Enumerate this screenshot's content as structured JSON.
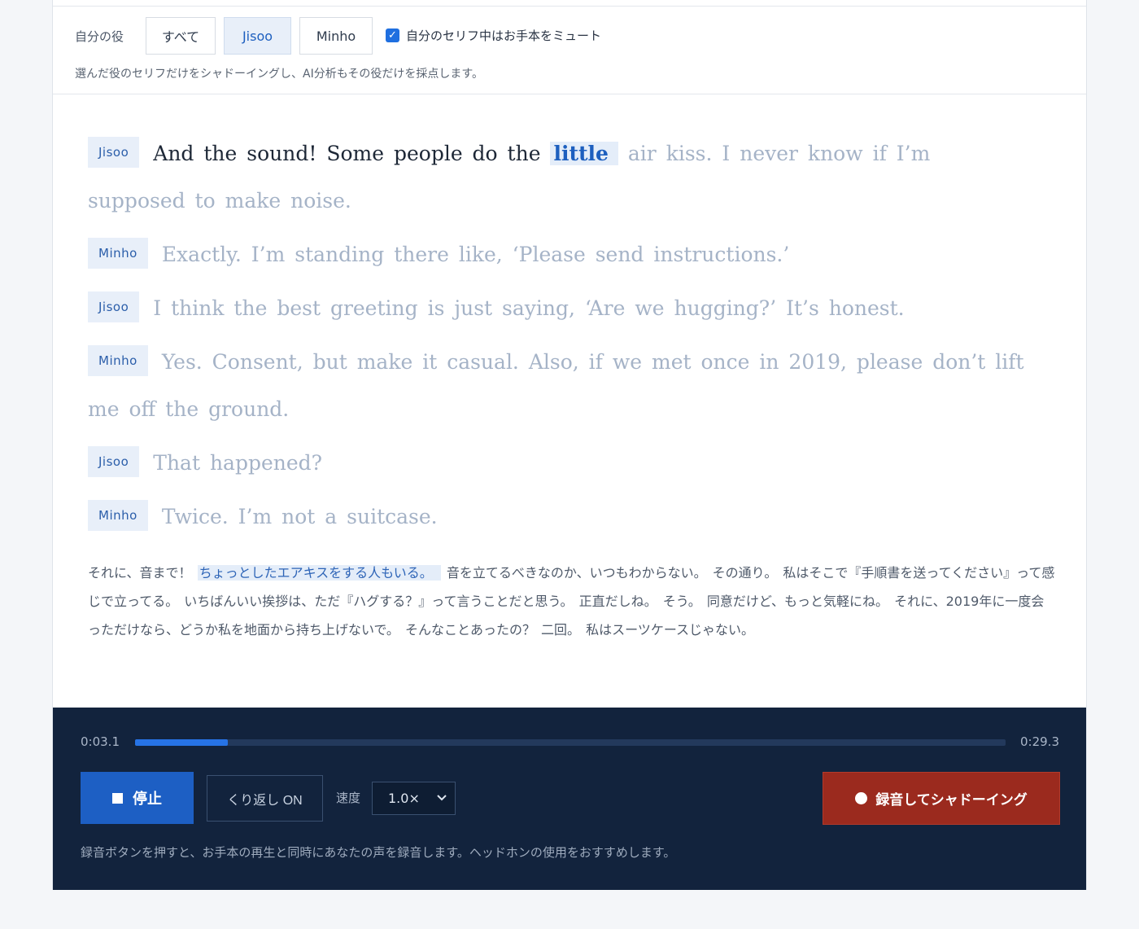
{
  "role_bar": {
    "label": "自分の役",
    "buttons": [
      "すべて",
      "Jisoo",
      "Minho"
    ],
    "active": "Jisoo",
    "mute_label": "自分のセリフ中はお手本をミュート",
    "mute_checked": true,
    "hint": "選んだ役のセリフだけをシャドーイングし、AI分析もその役だけを採点します。"
  },
  "script": {
    "lines": [
      {
        "speaker": "Jisoo",
        "spoken": "And the sound! Some people do the",
        "highlight": "little",
        "rest": " air kiss. I never know if I’m supposed to make noise."
      },
      {
        "speaker": "Minho",
        "spoken": "",
        "highlight": "",
        "rest": "Exactly. I’m standing there like, ‘Please send instructions.’"
      },
      {
        "speaker": "Jisoo",
        "spoken": "",
        "highlight": "",
        "rest": "I think the best greeting is just saying, ‘Are we hugging?’ It’s honest."
      },
      {
        "speaker": "Minho",
        "spoken": "",
        "highlight": "",
        "rest": "Yes. Consent, but make it casual. Also, if we met once in 2019, please don’t lift me off the ground."
      },
      {
        "speaker": "Jisoo",
        "spoken": "",
        "highlight": "",
        "rest": "That happened?"
      },
      {
        "speaker": "Minho",
        "spoken": "",
        "highlight": "",
        "rest": "Twice. I’m not a suitcase."
      }
    ]
  },
  "translation": {
    "before": "それに、音まで！ ",
    "highlight": "ちょっとしたエアキスをする人もいる。",
    "after": " 音を立てるべきなのか、いつもわからない。 その通り。 私はそこで『手順書を送ってください』って感じで立ってる。 いちばんいい挨拶は、ただ『ハグする？』って言うことだと思う。 正直だしね。 そう。 同意だけど、もっと気軽にね。 それに、2019年に一度会っただけなら、どうか私を地面から持ち上げないで。 そんなことあったの？ 二回。 私はスーツケースじゃない。"
  },
  "player": {
    "current_time": "0:03.1",
    "total_time": "0:29.3",
    "progress": 0.107,
    "stop_label": "停止",
    "loop_label": "くり返し ON",
    "speed_label": "速度",
    "speed_value": "1.0×",
    "record_label": "録音してシャドーイング",
    "hint": "録音ボタンを押すと、お手本の再生と同時にあなたの声を録音します。ヘッドホンの使用をおすすめします。"
  },
  "colors": {
    "accent": "#1d5fc4",
    "record": "#9b2a1e",
    "player_bg": "#12233d"
  }
}
